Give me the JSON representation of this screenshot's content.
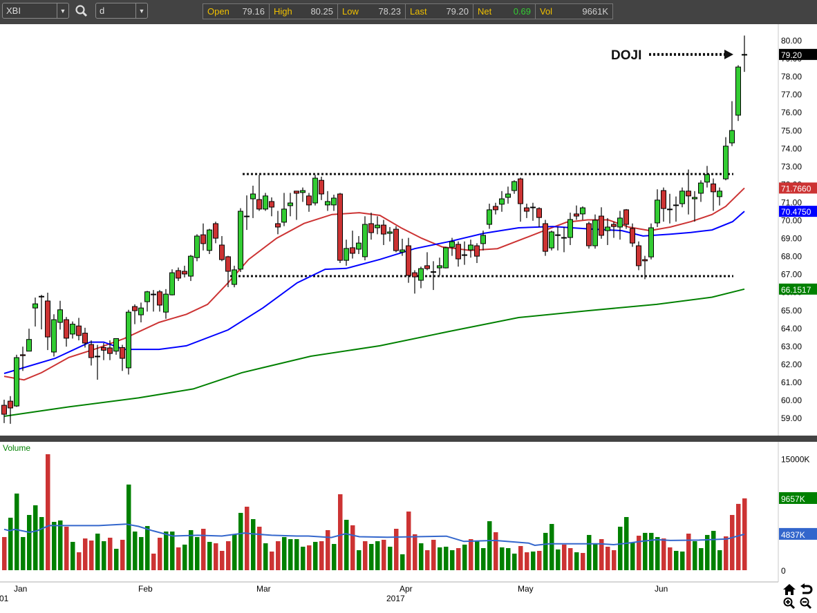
{
  "toolbar": {
    "symbol": "XBI",
    "interval": "d",
    "quote": {
      "open_label": "Open",
      "open": "79.16",
      "high_label": "High",
      "high": "80.25",
      "low_label": "Low",
      "low": "78.23",
      "last_label": "Last",
      "last": "79.20",
      "net_label": "Net",
      "net": "0.69",
      "vol_label": "Vol",
      "vol": "9661K"
    }
  },
  "colors": {
    "up_candle": "#33cc33",
    "down_candle": "#cc3333",
    "up_volume": "#008000",
    "down_volume": "#cc3333",
    "ma_red": "#cc3333",
    "ma_blue": "#0000ff",
    "ma_green": "#008000",
    "volume_ma": "#3366cc",
    "net_positive": "#33cc33",
    "label_yellow": "#f0c000"
  },
  "chart_data": {
    "type": "candlestick",
    "symbol": "XBI",
    "x_labels": [
      {
        "index": 2,
        "label": "Jan"
      },
      {
        "index": 22,
        "label": "Feb"
      },
      {
        "index": 41,
        "label": "Mar"
      },
      {
        "index": 64,
        "label": "Apr"
      },
      {
        "index": 83,
        "label": "May"
      },
      {
        "index": 105,
        "label": "Jun"
      }
    ],
    "year_labels": [
      {
        "index": 0,
        "label": "01"
      },
      {
        "index": 63,
        "label": "2017"
      }
    ],
    "ylim": [
      58.25,
      81.1
    ],
    "y_ticks": [
      "80.00",
      "79.00",
      "78.00",
      "77.00",
      "76.00",
      "75.00",
      "74.00",
      "73.00",
      "72.00",
      "71.00",
      "70.00",
      "69.00",
      "68.00",
      "67.00",
      "66.00",
      "65.00",
      "64.00",
      "63.00",
      "62.00",
      "61.00",
      "60.00",
      "59.00"
    ],
    "ohlc": [
      [
        59.69,
        60.0,
        58.7,
        59.19
      ],
      [
        59.92,
        60.2,
        58.66,
        59.54
      ],
      [
        59.65,
        62.5,
        59.6,
        62.34
      ],
      [
        62.5,
        62.95,
        61.6,
        62.45
      ],
      [
        62.7,
        63.95,
        62.7,
        63.35
      ],
      [
        65.1,
        65.68,
        64.07,
        65.33
      ],
      [
        65.72,
        65.83,
        63.91,
        65.75
      ],
      [
        65.49,
        65.95,
        62.76,
        63.49
      ],
      [
        62.65,
        64.75,
        62.4,
        64.45
      ],
      [
        64.3,
        65.5,
        63.9,
        65.0
      ],
      [
        64.45,
        64.6,
        62.95,
        63.42
      ],
      [
        63.65,
        64.35,
        63.4,
        64.2
      ],
      [
        64.1,
        64.55,
        63.3,
        63.57
      ],
      [
        63.7,
        64.0,
        62.9,
        63.15
      ],
      [
        63.07,
        63.3,
        61.9,
        62.34
      ],
      [
        62.4,
        63.05,
        61.11,
        62.42
      ],
      [
        62.9,
        63.15,
        62.2,
        62.75
      ],
      [
        62.88,
        63.3,
        62.2,
        62.57
      ],
      [
        62.7,
        63.4,
        62.5,
        63.4
      ],
      [
        62.9,
        63.05,
        61.6,
        62.3
      ],
      [
        61.77,
        65.0,
        61.4,
        64.87
      ],
      [
        65.18,
        65.3,
        64.2,
        64.95
      ],
      [
        64.72,
        65.4,
        64.3,
        65.1
      ],
      [
        65.45,
        66.05,
        64.9,
        66.0
      ],
      [
        65.85,
        66.1,
        64.9,
        65.87
      ],
      [
        66.0,
        66.1,
        64.9,
        65.26
      ],
      [
        64.87,
        66.15,
        64.5,
        65.87
      ],
      [
        65.83,
        67.25,
        65.8,
        67.06
      ],
      [
        67.18,
        67.35,
        66.6,
        66.76
      ],
      [
        67.14,
        67.45,
        66.8,
        66.99
      ],
      [
        66.87,
        68.05,
        66.6,
        67.98
      ],
      [
        67.9,
        69.2,
        67.7,
        69.1
      ],
      [
        69.17,
        69.8,
        68.3,
        68.68
      ],
      [
        68.3,
        69.5,
        68.1,
        69.44
      ],
      [
        69.79,
        69.9,
        68.7,
        68.98
      ],
      [
        68.6,
        69.1,
        67.7,
        67.79
      ],
      [
        67.95,
        68.0,
        66.26,
        67.14
      ],
      [
        66.41,
        67.45,
        66.25,
        67.22
      ],
      [
        67.26,
        70.65,
        67.1,
        70.48
      ],
      [
        70.2,
        71.36,
        69.44,
        70.21
      ],
      [
        71.17,
        71.9,
        70.1,
        71.44
      ],
      [
        71.13,
        72.5,
        70.5,
        70.6
      ],
      [
        70.6,
        71.5,
        70.5,
        71.33
      ],
      [
        71.02,
        71.25,
        70.2,
        70.71
      ],
      [
        69.79,
        70.5,
        69.2,
        69.6
      ],
      [
        69.87,
        71.5,
        69.65,
        70.6
      ],
      [
        70.79,
        71.5,
        70.2,
        70.94
      ],
      [
        71.6,
        71.6,
        70.0,
        71.48
      ],
      [
        71.52,
        71.8,
        71.0,
        71.63
      ],
      [
        71.33,
        71.5,
        70.45,
        70.83
      ],
      [
        70.94,
        72.5,
        70.8,
        72.32
      ],
      [
        72.2,
        72.4,
        71.1,
        71.44
      ],
      [
        70.83,
        71.6,
        70.5,
        71.02
      ],
      [
        70.83,
        71.4,
        70.5,
        71.21
      ],
      [
        71.44,
        71.5,
        67.6,
        67.75
      ],
      [
        67.75,
        68.9,
        67.45,
        68.41
      ],
      [
        68.45,
        69.4,
        67.85,
        68.14
      ],
      [
        68.37,
        69.1,
        68.1,
        68.71
      ],
      [
        67.95,
        70.2,
        67.75,
        69.75
      ],
      [
        69.79,
        70.4,
        68.9,
        69.29
      ],
      [
        69.56,
        70.2,
        69.2,
        69.71
      ],
      [
        69.71,
        70.0,
        68.6,
        69.21
      ],
      [
        69.25,
        69.6,
        68.8,
        69.33
      ],
      [
        69.48,
        69.65,
        68.2,
        68.29
      ],
      [
        68.21,
        68.95,
        68.0,
        68.33
      ],
      [
        68.56,
        69.0,
        66.5,
        66.91
      ],
      [
        67.06,
        67.2,
        65.9,
        66.83
      ],
      [
        66.64,
        67.4,
        66.2,
        67.29
      ],
      [
        67.45,
        68.2,
        67.2,
        67.29
      ],
      [
        67.1,
        67.7,
        66.1,
        67.12
      ],
      [
        67.33,
        67.9,
        66.9,
        67.45
      ],
      [
        67.33,
        68.5,
        67.3,
        68.45
      ],
      [
        68.48,
        69.0,
        68.0,
        68.79
      ],
      [
        68.64,
        68.8,
        67.4,
        67.83
      ],
      [
        68.06,
        68.8,
        67.5,
        68.06
      ],
      [
        68.33,
        68.9,
        67.9,
        68.6
      ],
      [
        68.56,
        68.7,
        67.6,
        67.98
      ],
      [
        68.68,
        69.4,
        68.3,
        69.14
      ],
      [
        69.75,
        70.9,
        69.5,
        70.56
      ],
      [
        70.75,
        70.95,
        70.3,
        70.56
      ],
      [
        70.87,
        71.6,
        70.45,
        71.17
      ],
      [
        71.25,
        71.85,
        70.9,
        71.44
      ],
      [
        71.63,
        72.2,
        71.45,
        72.13
      ],
      [
        72.28,
        72.35,
        69.9,
        70.9
      ],
      [
        70.67,
        70.9,
        70.1,
        70.48
      ],
      [
        70.7,
        70.95,
        69.95,
        70.71
      ],
      [
        70.63,
        70.7,
        69.6,
        70.13
      ],
      [
        69.79,
        70.0,
        68.0,
        68.25
      ],
      [
        68.44,
        69.4,
        68.3,
        69.33
      ],
      [
        69.15,
        69.6,
        68.3,
        69.17
      ],
      [
        69.0,
        69.6,
        68.2,
        69.02
      ],
      [
        69.02,
        70.4,
        68.6,
        70.02
      ],
      [
        70.33,
        70.8,
        70.0,
        70.21
      ],
      [
        70.33,
        70.75,
        70.0,
        70.67
      ],
      [
        69.79,
        69.9,
        68.4,
        68.56
      ],
      [
        68.56,
        70.3,
        68.4,
        69.98
      ],
      [
        70.21,
        70.7,
        68.95,
        69.14
      ],
      [
        69.4,
        70.1,
        68.6,
        69.6
      ],
      [
        69.75,
        69.9,
        69.0,
        69.63
      ],
      [
        69.6,
        70.5,
        68.9,
        70.1
      ],
      [
        70.56,
        70.6,
        69.5,
        69.75
      ],
      [
        69.52,
        69.8,
        68.5,
        68.71
      ],
      [
        68.56,
        68.8,
        67.2,
        67.45
      ],
      [
        67.79,
        68.0,
        66.7,
        67.72
      ],
      [
        67.94,
        69.8,
        67.8,
        69.56
      ],
      [
        69.83,
        71.7,
        69.6,
        71.1
      ],
      [
        71.63,
        71.8,
        69.9,
        70.63
      ],
      [
        70.58,
        71.45,
        69.8,
        70.6
      ],
      [
        70.8,
        71.3,
        69.9,
        70.83
      ],
      [
        70.9,
        71.8,
        70.7,
        71.6
      ],
      [
        71.6,
        72.8,
        70.3,
        71.33
      ],
      [
        71.17,
        71.6,
        69.9,
        71.25
      ],
      [
        71.48,
        72.2,
        71.0,
        72.05
      ],
      [
        72.1,
        73.0,
        71.8,
        72.52
      ],
      [
        72.0,
        72.3,
        70.5,
        71.56
      ],
      [
        71.29,
        71.8,
        70.8,
        71.6
      ],
      [
        72.28,
        74.6,
        72.2,
        74.1
      ],
      [
        74.28,
        76.6,
        74.1,
        74.97
      ],
      [
        75.82,
        78.6,
        75.5,
        78.5
      ],
      [
        79.16,
        80.25,
        78.23,
        79.2
      ]
    ],
    "moving_averages": [
      {
        "name": "ma-red",
        "color": "#cc3333",
        "last_value": "71.7660",
        "points": [
          [
            0,
            61.3
          ],
          [
            3.2,
            61.1
          ],
          [
            6,
            61.5
          ],
          [
            10.4,
            62.35
          ],
          [
            14.9,
            62.85
          ],
          [
            19.3,
            63.4
          ],
          [
            24.9,
            64.3
          ],
          [
            29.3,
            64.75
          ],
          [
            32.7,
            65.3
          ],
          [
            36,
            66.5
          ],
          [
            39.3,
            67.8
          ],
          [
            43.8,
            68.98
          ],
          [
            48.2,
            69.8
          ],
          [
            52.7,
            70.3
          ],
          [
            57.1,
            70.4
          ],
          [
            60.4,
            70.25
          ],
          [
            63.8,
            69.56
          ],
          [
            67.1,
            68.98
          ],
          [
            70.4,
            68.5
          ],
          [
            74.9,
            68.3
          ],
          [
            79.3,
            68.4
          ],
          [
            83.8,
            69.0
          ],
          [
            87.1,
            69.44
          ],
          [
            90.4,
            69.87
          ],
          [
            93.8,
            70.0
          ],
          [
            97.1,
            70.0
          ],
          [
            100.4,
            69.6
          ],
          [
            103.8,
            69.4
          ],
          [
            107.1,
            69.6
          ],
          [
            110.4,
            69.9
          ],
          [
            113.8,
            70.3
          ],
          [
            116,
            70.75
          ],
          [
            119,
            71.77
          ]
        ]
      },
      {
        "name": "ma-blue",
        "color": "#0000ff",
        "last_value": "70.4750",
        "points": [
          [
            0,
            61.46
          ],
          [
            8.2,
            62.3
          ],
          [
            13.8,
            63.2
          ],
          [
            16,
            63.2
          ],
          [
            19.3,
            62.8
          ],
          [
            24.9,
            62.8
          ],
          [
            29.3,
            63.0
          ],
          [
            36,
            63.88
          ],
          [
            41.6,
            65.1
          ],
          [
            47.1,
            66.5
          ],
          [
            51.6,
            67.25
          ],
          [
            55,
            67.3
          ],
          [
            60.4,
            67.8
          ],
          [
            66,
            68.4
          ],
          [
            71.6,
            68.8
          ],
          [
            77.1,
            69.25
          ],
          [
            82.7,
            69.56
          ],
          [
            88.2,
            69.63
          ],
          [
            93.8,
            69.5
          ],
          [
            99.3,
            69.4
          ],
          [
            102.7,
            69.1
          ],
          [
            107.1,
            69.2
          ],
          [
            110.4,
            69.3
          ],
          [
            113.8,
            69.44
          ],
          [
            117.1,
            69.9
          ],
          [
            119,
            70.475
          ]
        ]
      },
      {
        "name": "ma-green",
        "color": "#008000",
        "last_value": "66.1517",
        "points": [
          [
            0,
            59.08
          ],
          [
            10.4,
            59.6
          ],
          [
            21.6,
            60.1
          ],
          [
            30.4,
            60.6
          ],
          [
            38.2,
            61.5
          ],
          [
            49.3,
            62.42
          ],
          [
            60.4,
            63.0
          ],
          [
            71.6,
            63.8
          ],
          [
            82.7,
            64.57
          ],
          [
            93.8,
            64.95
          ],
          [
            104.9,
            65.3
          ],
          [
            113.8,
            65.7
          ],
          [
            119,
            66.15
          ]
        ]
      }
    ],
    "last_price_label": "79.20",
    "horizontal_lines": [
      {
        "name": "resistance-line",
        "price": 72.55,
        "from_index": 39,
        "to_index": 117
      },
      {
        "name": "support-line",
        "price": 66.87,
        "from_index": 37,
        "to_index": 117
      }
    ],
    "annotation": {
      "text": "DOJI",
      "price": 79.2
    },
    "volume": {
      "title": "Volume",
      "ylim": [
        0,
        17700
      ],
      "tick_labels": [
        {
          "value": 15000,
          "label": "15000K"
        },
        {
          "value": 0,
          "label": "0"
        }
      ],
      "last_label": "9657K",
      "ma_label": "4837K",
      "values_k": [
        4460,
        7060,
        10310,
        4460,
        7430,
        8730,
        7150,
        15600,
        6500,
        6690,
        5850,
        3810,
        2410,
        4270,
        3990,
        4920,
        3900,
        4370,
        2880,
        4090,
        11520,
        5200,
        4460,
        5940,
        2230,
        4370,
        5200,
        5200,
        3070,
        3440,
        5390,
        4460,
        5570,
        3810,
        3620,
        2600,
        3900,
        4830,
        7710,
        8540,
        6870,
        5850,
        3620,
        2510,
        3900,
        4460,
        4180,
        4180,
        3160,
        3340,
        3810,
        3900,
        5390,
        3530,
        10220,
        6780,
        6040,
        2690,
        3900,
        3530,
        3900,
        4090,
        3160,
        5570,
        2140,
        7890,
        4830,
        3620,
        2690,
        4090,
        3070,
        3160,
        2690,
        2970,
        3440,
        4180,
        3900,
        2970,
        6590,
        5110,
        3070,
        2970,
        2230,
        3250,
        2410,
        2510,
        2600,
        5020,
        6220,
        2790,
        3440,
        2970,
        2410,
        2320,
        4740,
        3530,
        4180,
        3160,
        2690,
        5850,
        7150,
        3720,
        4640,
        5020,
        5020,
        4460,
        4270,
        3070,
        2600,
        2510,
        4920,
        3900,
        2970,
        4740,
        5290,
        2690,
        4550,
        7430,
        8920,
        9660
      ],
      "directions": "DGGGGGGDGGDGDDDGGDGDGGGGDDGGDGGGDGDDDGGDGDGDDGGGGDGDDGDGDGDGGDGDGDDGDDGGGDGDGGGDGGGDDGDGGGDDGDGGDDDGGGDGGGDDGGDGGGGG",
      "ma_points": [
        [
          0,
          5.5
        ],
        [
          0.9,
          5.3
        ],
        [
          1.7,
          5.5
        ],
        [
          4.1,
          5.1
        ],
        [
          5.3,
          5.3
        ],
        [
          7.2,
          6.0
        ],
        [
          9.2,
          6.0
        ],
        [
          15.2,
          6.0
        ],
        [
          19.6,
          6.2
        ],
        [
          21.6,
          5.9
        ],
        [
          23.9,
          5.3
        ],
        [
          27.1,
          4.6
        ],
        [
          31.1,
          4.7
        ],
        [
          35,
          4.6
        ],
        [
          38.7,
          5.0
        ],
        [
          39.8,
          4.9
        ],
        [
          43,
          4.7
        ],
        [
          47,
          4.6
        ],
        [
          48.9,
          4.6
        ],
        [
          52.6,
          4.4
        ],
        [
          54.9,
          4.9
        ],
        [
          57.1,
          4.5
        ],
        [
          61.6,
          4.43
        ],
        [
          71.1,
          4.58
        ],
        [
          73.9,
          3.87
        ],
        [
          78.9,
          4.0
        ],
        [
          84.3,
          3.65
        ],
        [
          85.3,
          3.34
        ],
        [
          87.6,
          3.56
        ],
        [
          95.8,
          3.56
        ],
        [
          98,
          3.44
        ],
        [
          100.3,
          3.65
        ],
        [
          102.6,
          3.9
        ],
        [
          104.9,
          4.1
        ],
        [
          107.1,
          4.0
        ],
        [
          111.7,
          4.05
        ],
        [
          116.2,
          4.2
        ],
        [
          119,
          4.84
        ]
      ]
    }
  }
}
